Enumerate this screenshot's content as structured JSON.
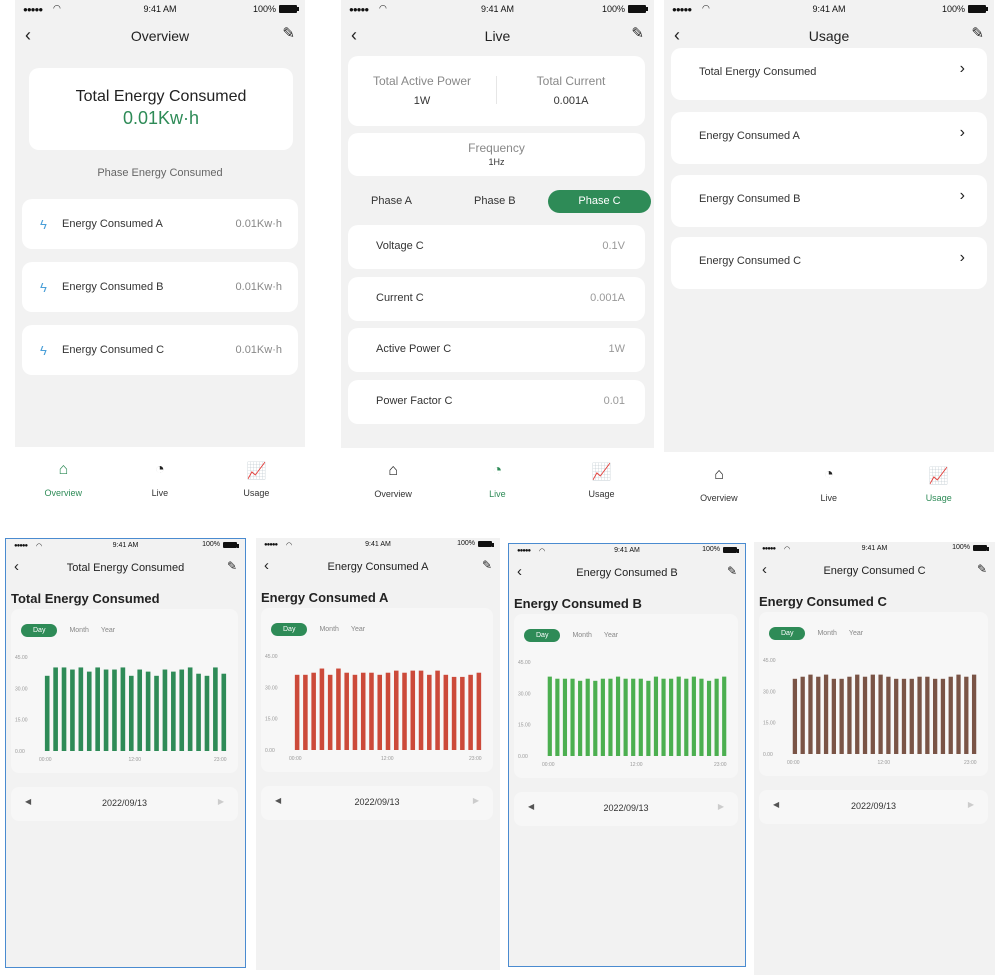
{
  "status": {
    "time": "9:41 AM",
    "battery": "100%"
  },
  "overview": {
    "nav_title": "Overview",
    "total_title": "Total Energy Consumed",
    "total_value": "0.01Kw·h",
    "phase_heading": "Phase Energy Consumed",
    "items": [
      {
        "label": "Energy Consumed A",
        "value": "0.01Kw·h"
      },
      {
        "label": "Energy Consumed B",
        "value": "0.01Kw·h"
      },
      {
        "label": "Energy Consumed C",
        "value": "0.01Kw·h"
      }
    ]
  },
  "live": {
    "nav_title": "Live",
    "active_power_label": "Total Active Power",
    "active_power_value": "1W",
    "current_label": "Total Current",
    "current_value": "0.001A",
    "frequency_label": "Frequency",
    "frequency_value": "1Hz",
    "phases": [
      "Phase A",
      "Phase B",
      "Phase C"
    ],
    "selected_phase": "Phase C",
    "rows": [
      {
        "label": "Voltage C",
        "value": "0.1V"
      },
      {
        "label": "Current C",
        "value": "0.001A"
      },
      {
        "label": "Active Power C",
        "value": "1W"
      },
      {
        "label": "Power Factor C",
        "value": "0.01"
      }
    ]
  },
  "usage": {
    "nav_title": "Usage",
    "items": [
      "Total Energy Consumed",
      "Energy Consumed A",
      "Energy Consumed B",
      "Energy Consumed C"
    ]
  },
  "tabs": [
    "Overview",
    "Live",
    "Usage"
  ],
  "icons": {
    "back": "back-chevron-icon",
    "edit": "edit-pencil-icon",
    "home": "home-icon",
    "live": "gauge-icon",
    "usage": "bar-chart-icon",
    "bolt": "lightning-bolt-icon",
    "chevron": "chevron-right-icon"
  },
  "colors": {
    "accent": "#2e8b57",
    "total": "#2e8b57",
    "a": "#cc4a3a",
    "b": "#4caf50",
    "c": "#7a5446"
  },
  "detail_screens": [
    {
      "nav_title": "Total Energy Consumed",
      "heading": "Total Energy Consumed",
      "date": "2022/09/13"
    },
    {
      "nav_title": "Energy Consumed A",
      "heading": "Energy Consumed A",
      "date": "2022/09/13"
    },
    {
      "nav_title": "Energy Consumed B",
      "heading": "Energy Consumed B",
      "date": "2022/09/13"
    },
    {
      "nav_title": "Energy Consumed C",
      "heading": "Energy Consumed C",
      "date": "2022/09/13"
    }
  ],
  "segments": [
    "Day",
    "Month",
    "Year"
  ],
  "chart_data": [
    {
      "type": "bar",
      "title": "Total Energy Consumed",
      "yticks": [
        "45.00",
        "30.00",
        "15.00",
        "0.00"
      ],
      "ylim": [
        0,
        45
      ],
      "xticks": [
        "00:00",
        "12:00",
        "23:00"
      ],
      "values": [
        36,
        40,
        40,
        39,
        40,
        38,
        40,
        39,
        39,
        40,
        36,
        39,
        38,
        36,
        39,
        38,
        39,
        40,
        37,
        36,
        40,
        37
      ]
    },
    {
      "type": "bar",
      "title": "Energy Consumed A",
      "yticks": [
        "45.00",
        "30.00",
        "15.00",
        "0.00"
      ],
      "ylim": [
        0,
        45
      ],
      "xticks": [
        "00:00",
        "12:00",
        "23:00"
      ],
      "values": [
        36,
        36,
        37,
        39,
        36,
        39,
        37,
        36,
        37,
        37,
        36,
        37,
        38,
        37,
        38,
        38,
        36,
        38,
        36,
        35,
        35,
        36,
        37
      ]
    },
    {
      "type": "bar",
      "title": "Energy Consumed B",
      "yticks": [
        "45.00",
        "30.00",
        "15.00",
        "0.00"
      ],
      "ylim": [
        0,
        45
      ],
      "xticks": [
        "00:00",
        "12:00",
        "23:00"
      ],
      "values": [
        38,
        37,
        37,
        37,
        36,
        37,
        36,
        37,
        37,
        38,
        37,
        37,
        37,
        36,
        38,
        37,
        37,
        38,
        37,
        38,
        37,
        36,
        37,
        38
      ]
    },
    {
      "type": "bar",
      "title": "Energy Consumed C",
      "yticks": [
        "45.00",
        "30.00",
        "15.00",
        "0.00"
      ],
      "ylim": [
        0,
        45
      ],
      "xticks": [
        "00:00",
        "12:00",
        "23:00"
      ],
      "values": [
        36,
        37,
        38,
        37,
        38,
        36,
        36,
        37,
        38,
        37,
        38,
        38,
        37,
        36,
        36,
        36,
        37,
        37,
        36,
        36,
        37,
        38,
        37,
        38
      ]
    }
  ]
}
